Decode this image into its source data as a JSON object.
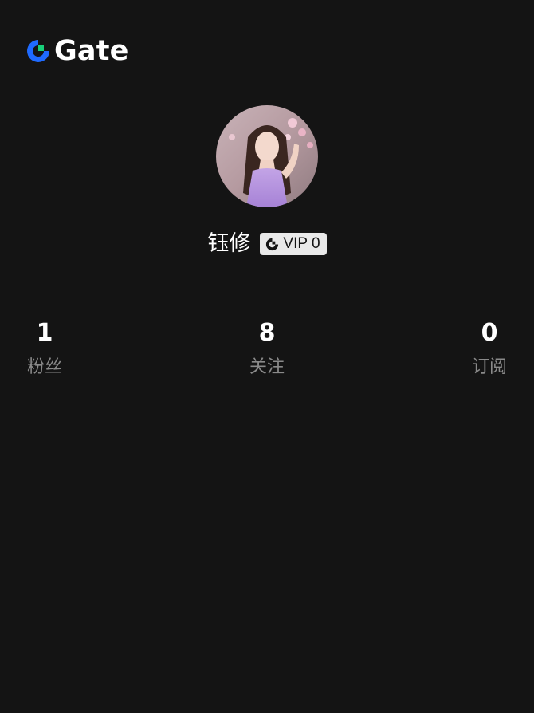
{
  "header": {
    "brand_name": "Gate",
    "logo_icon": "gate-logo-icon"
  },
  "profile": {
    "avatar_icon": "user-avatar",
    "username": "钰修",
    "vip_badge": {
      "icon": "gate-mark-icon",
      "label": "VIP 0"
    }
  },
  "stats": [
    {
      "value": "1",
      "label": "粉丝"
    },
    {
      "value": "8",
      "label": "关注"
    },
    {
      "value": "0",
      "label": "订阅"
    }
  ],
  "colors": {
    "background": "#141414",
    "brand_blue": "#1f6bff",
    "brand_green": "#18d07a",
    "muted_text": "#8a8a8a",
    "badge_bg": "#e9e9e9"
  }
}
